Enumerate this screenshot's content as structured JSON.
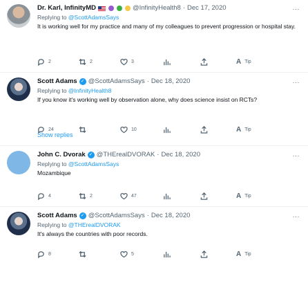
{
  "tweets": [
    {
      "name": "Dr. Karl, InfinityMD",
      "handle": "@InfinityHealth8",
      "date": "Dec 17, 2020",
      "reply_prefix": "Replying to",
      "reply_to": "@ScottAdamsSays",
      "text": "It is working well for my practice and many  of my colleagues to prevent progression or hospital stay.",
      "replies": "2",
      "retweets": "2",
      "likes": "3",
      "tip": "Tip"
    },
    {
      "name": "Scott Adams",
      "handle": "@ScottAdamsSays",
      "date": "Dec 18, 2020",
      "reply_prefix": "Replying to",
      "reply_to": "@InfinityHealth8",
      "text": "If you know it's working well by observation alone, why does science insist on RCTs?",
      "replies": "24",
      "retweets": "",
      "likes": "10",
      "tip": "Tip"
    },
    {
      "name": "John C. Dvorak",
      "handle": "@THErealDVORAK",
      "date": "Dec 18, 2020",
      "reply_prefix": "Replying to",
      "reply_to": "@ScottAdamsSays",
      "text": "Mozambique",
      "replies": "4",
      "retweets": "2",
      "likes": "47",
      "tip": "Tip"
    },
    {
      "name": "Scott Adams",
      "handle": "@ScottAdamsSays",
      "date": "Dec 18, 2020",
      "reply_prefix": "Replying to",
      "reply_to": "@THErealDVORAK",
      "text": "It's always the countries with poor records.",
      "replies": "8",
      "retweets": "",
      "likes": "5",
      "tip": "Tip"
    }
  ],
  "show_replies": "Show replies",
  "separator": "·",
  "more": "···",
  "verified_mark": "✓",
  "tip_glyph": "A",
  "colors": {
    "accent": "#1d9bf0",
    "muted": "#536471",
    "purple": "#9b59d0",
    "green": "#3cb043",
    "yellow": "#f7c948"
  },
  "icons": [
    "reply-icon",
    "retweet-icon",
    "like-icon",
    "analytics-icon",
    "share-icon",
    "tip-icon",
    "verified-icon"
  ]
}
